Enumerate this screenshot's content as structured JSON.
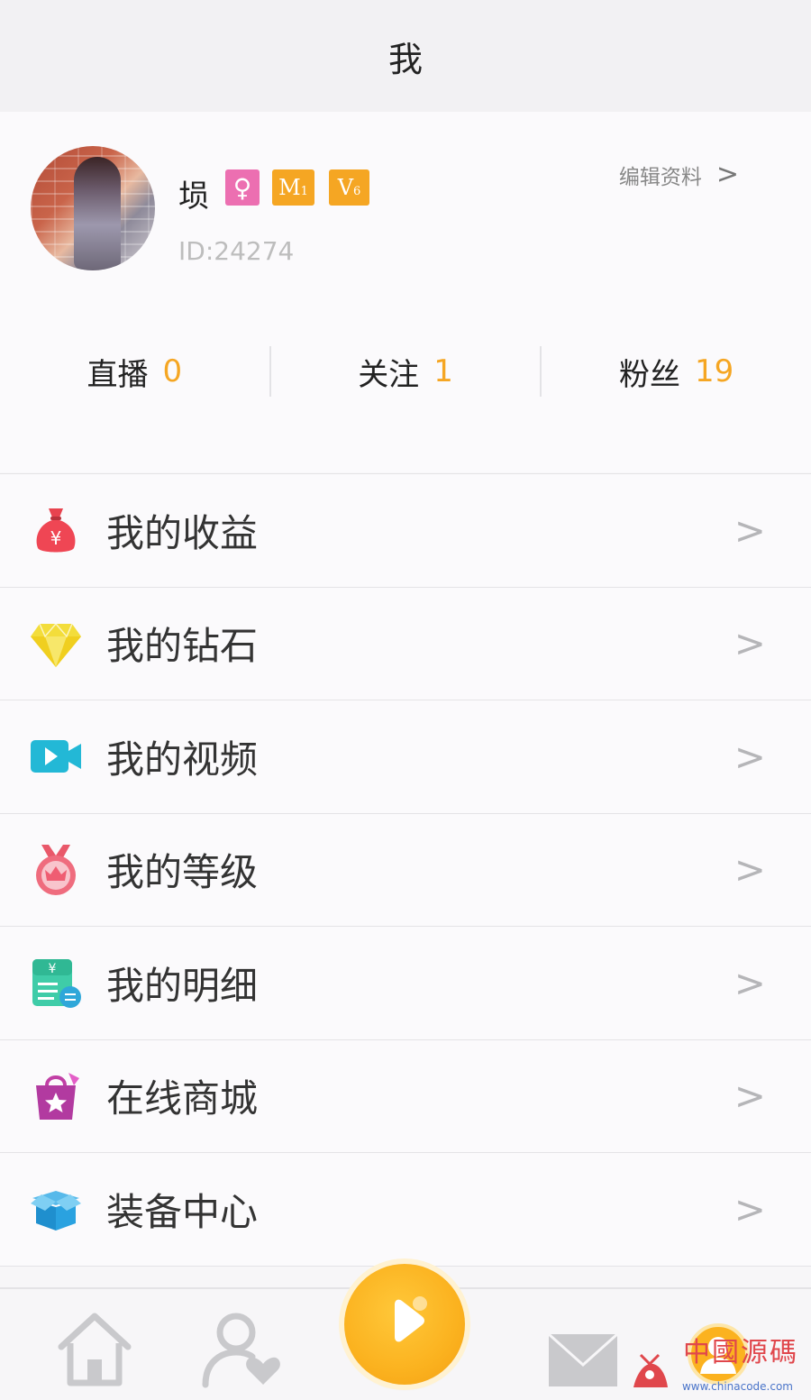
{
  "header": {
    "title": "我"
  },
  "profile": {
    "username": "埙",
    "gender_symbol": "♀",
    "badges": {
      "medal_letter": "M",
      "medal_level": "1",
      "vip_letter": "V",
      "vip_level": "6"
    },
    "id_text": "ID:24274",
    "edit_label": "编辑资料",
    "edit_chevron": ">"
  },
  "stats": [
    {
      "label": "直播",
      "value": "0"
    },
    {
      "label": "关注",
      "value": "1"
    },
    {
      "label": "粉丝",
      "value": "19"
    }
  ],
  "menu": [
    {
      "label": "我的收益",
      "icon": "money-bag-icon"
    },
    {
      "label": "我的钻石",
      "icon": "diamond-icon"
    },
    {
      "label": "我的视频",
      "icon": "video-camera-icon"
    },
    {
      "label": "我的等级",
      "icon": "medal-crown-icon"
    },
    {
      "label": "我的明细",
      "icon": "bill-detail-icon"
    },
    {
      "label": "在线商城",
      "icon": "shopping-bag-icon"
    },
    {
      "label": "装备中心",
      "icon": "box-icon"
    }
  ],
  "menu_chevron": ">",
  "tabbar": {
    "items": [
      "home-icon",
      "follow-user-heart-icon",
      "play-live-icon",
      "mail-icon",
      "profile-icon"
    ],
    "active": "profile-icon"
  },
  "watermark": {
    "text": "中國源碼",
    "url": "www.chinacode.com"
  },
  "colors": {
    "accent": "#f5a623",
    "gender_badge": "#ec6fb1",
    "divider": "#e4e3e6"
  }
}
